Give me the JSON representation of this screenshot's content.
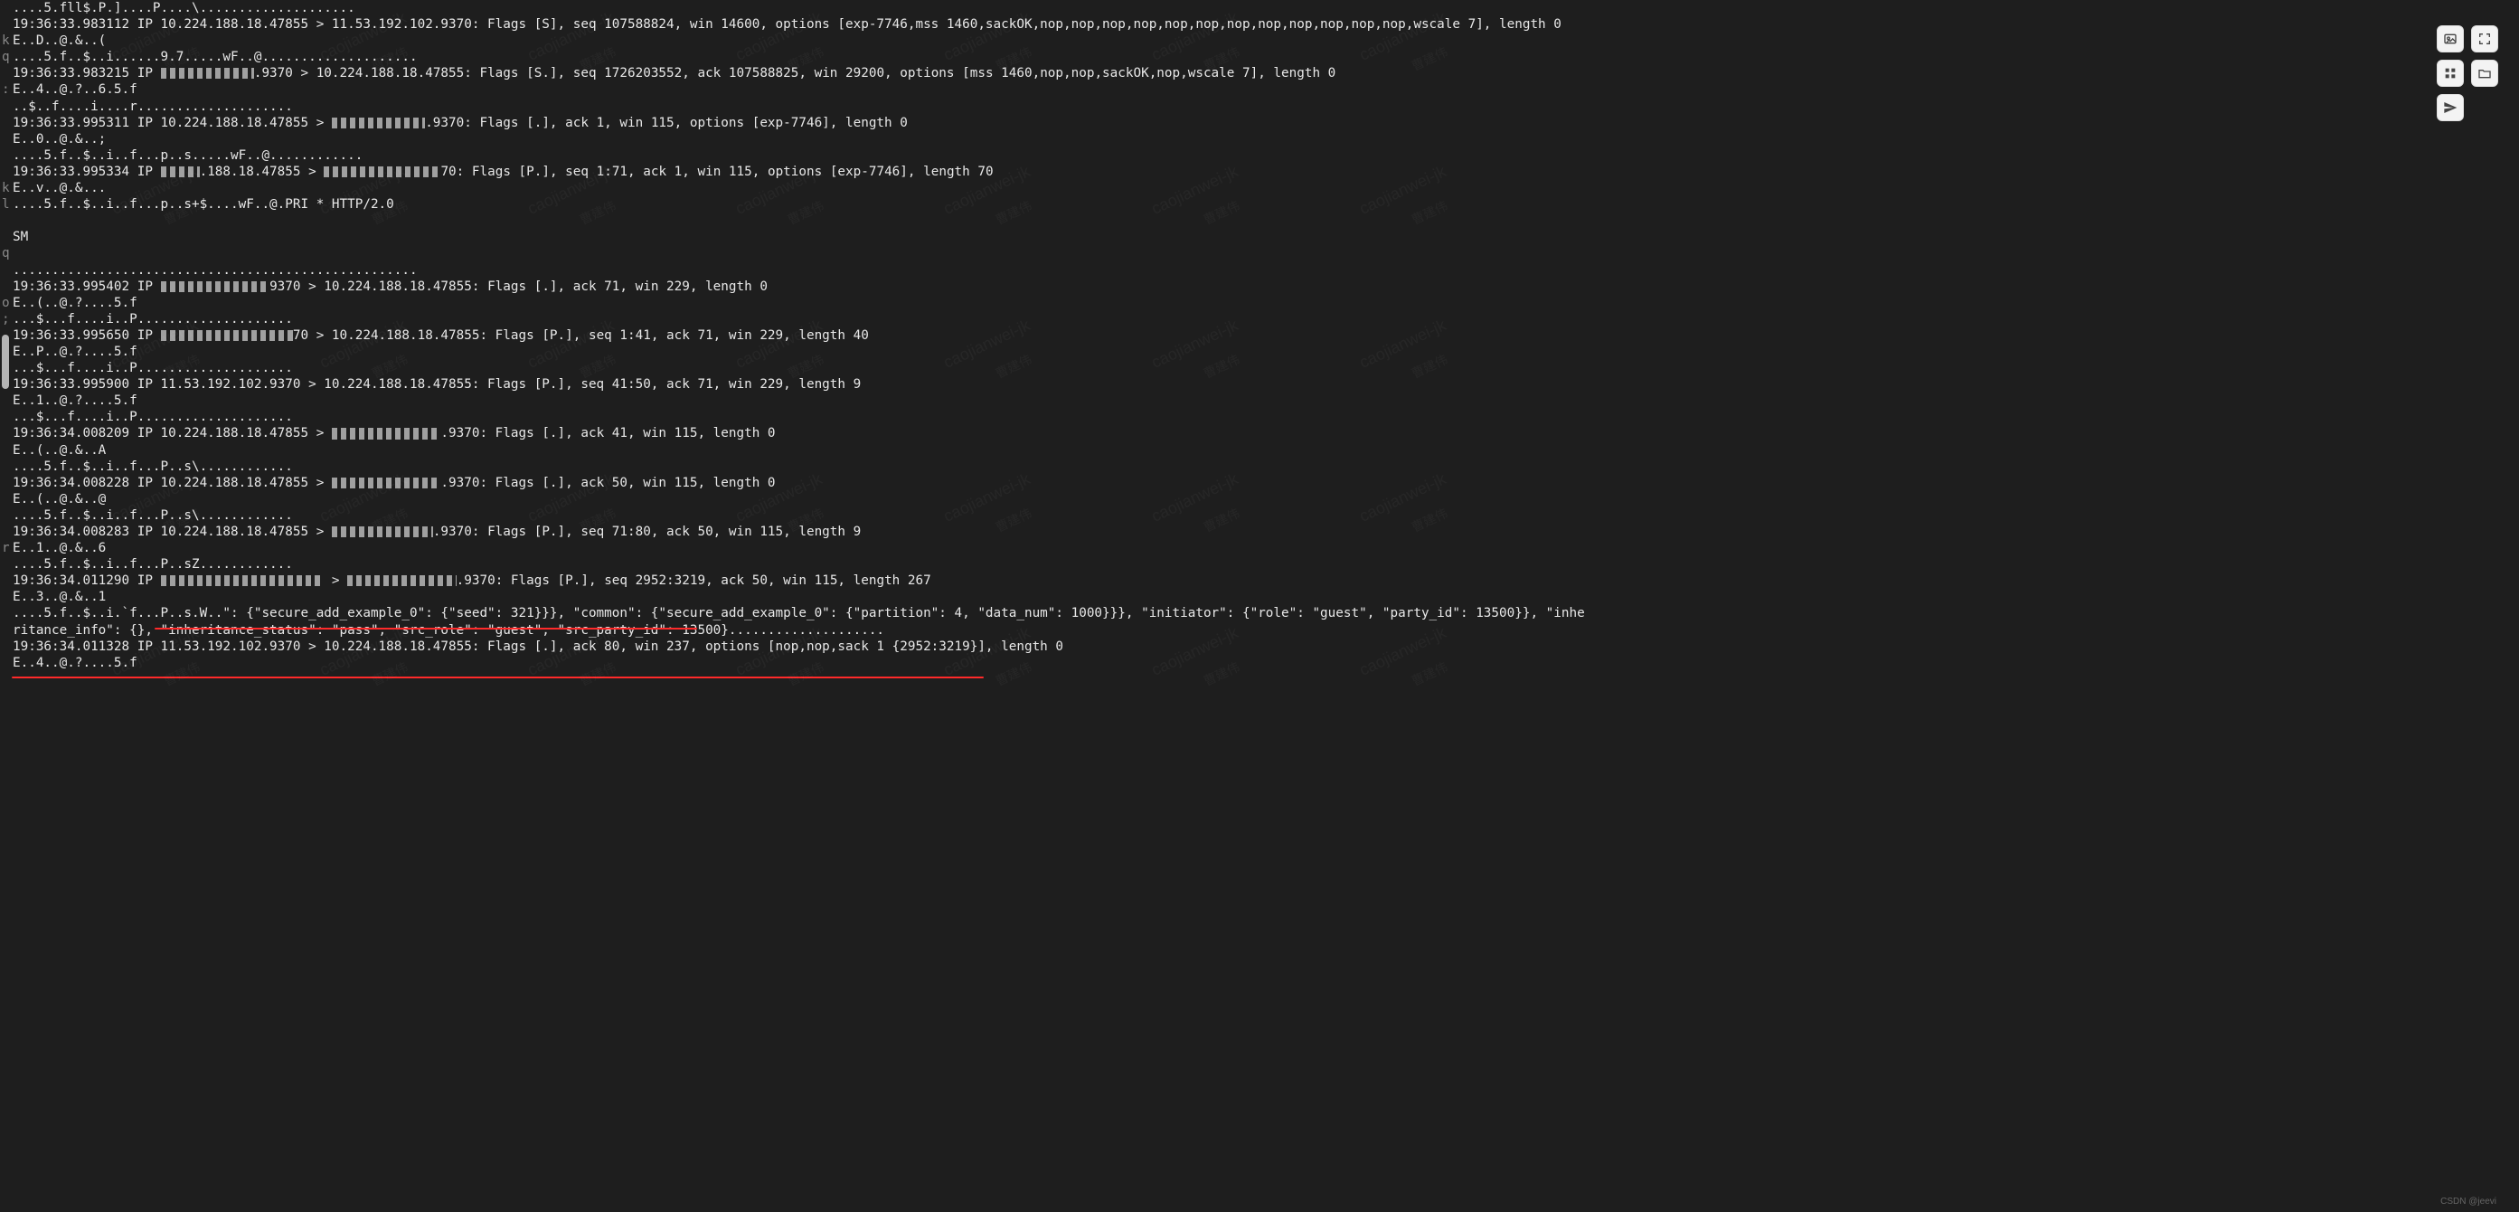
{
  "terminal": {
    "lines": [
      {
        "g": " ",
        "t": "....5.fll$.P.]....P....\\...................."
      },
      {
        "g": " ",
        "t": "19:36:33.983112 IP 10.224.188.18.47855 > 11.53.192.102.9370: Flags [S], seq 107588824, win 14600, options [exp-7746,mss 1460,sackOK,nop,nop,nop,nop,nop,nop,nop,nop,nop,nop,nop,nop,wscale 7], length 0"
      },
      {
        "g": "k",
        "t": "E..D..@.&..("
      },
      {
        "g": "q",
        "t": "....5.f..$..i......9.7.....wF..@...................."
      },
      {
        "g": " ",
        "t1": "19:36:33.983215 IP ",
        "ob": " .  .   .102",
        "t2": ".9370 > 10.224.188.18.47855: Flags [S.], seq 1726203552, ack 107588825, win 29200, options [mss 1460,nop,nop,sackOK,nop,wscale 7], length 0"
      },
      {
        "g": ":",
        "t": "E..4..@.?..6.5.f"
      },
      {
        "g": " ",
        "t": "..$..f....i....r...................."
      },
      {
        "g": " ",
        "t1": "19:36:33.995311 IP 10.224.188.18.47855 > ",
        "ob": " .  .   .102",
        "t2": ".9370: Flags [.], ack 1, win 115, options [exp-7746], length 0"
      },
      {
        "g": " ",
        "t": "E..0..@.&..;"
      },
      {
        "g": " ",
        "t": "....5.f..$..i..f...p..s.....wF..@............"
      },
      {
        "g": " ",
        "t1": "19:36:33.995334 IP ",
        "ob": " .224",
        "t2": ".188.18.47855 > ",
        "ob2": " .  .   .  .  3",
        "t3": "70: Flags [P.], seq 1:71, ack 1, win 115, options [exp-7746], length 70"
      },
      {
        "g": "k",
        "t": "E..v..@.&..."
      },
      {
        "g": "l",
        "t": "....5.f..$..i..f...p..s+$....wF..@.PRI * HTTP/2.0"
      },
      {
        "g": " ",
        "t": ""
      },
      {
        "g": " ",
        "t": "SM"
      },
      {
        "g": "q",
        "t": ""
      },
      {
        "g": " ",
        "t": "...................................................."
      },
      {
        "g": " ",
        "t1": "19:36:33.995402 IP ",
        "ob": " .   .   .    ",
        "t2": "9370 > 10.224.188.18.47855: Flags [.], ack 71, win 229, length 0"
      },
      {
        "g": "o",
        "t": "E..(..@.?....5.f"
      },
      {
        "g": ";",
        "t": "...$...f....i..P...................."
      },
      {
        "g": " ",
        "t1": "19:36:33.995650 IP ",
        "ob": " .   . .  .   . 3",
        "t2": "70 > 10.224.188.18.47855: Flags [P.], seq 1:41, ack 71, win 229, length 40"
      },
      {
        "g": " ",
        "t": "E..P..@.?....5.f"
      },
      {
        "g": " ",
        "t": "...$...f....i..P...................."
      },
      {
        "g": " ",
        "t": "19:36:33.995900 IP 11.53.192.102.9370 > 10.224.188.18.47855: Flags [P.], seq 41:50, ack 71, win 229, length 9"
      },
      {
        "g": " ",
        "t": "E..1..@.?....5.f"
      },
      {
        "g": " ",
        "t": "...$...f....i..P...................."
      },
      {
        "g": " ",
        "t1": "19:36:34.008209 IP 10.224.188.18.47855 > ",
        "ob": " .   . .. .102",
        "t2": ".9370: Flags [.], ack 41, win 115, length 0"
      },
      {
        "g": " ",
        "t": "E..(..@.&..A"
      },
      {
        "g": " ",
        "t": "....5.f..$..i..f...P..s\\............"
      },
      {
        "g": " ",
        "t1": "19:36:34.008228 IP 10.224.188.18.47855 > ",
        "ob": " .. .  .. .102",
        "t2": ".9370: Flags [.], ack 50, win 115, length 0"
      },
      {
        "g": " ",
        "t": "E..(..@.&..@"
      },
      {
        "g": " ",
        "t": "....5.f..$..i..f...P..s\\............"
      },
      {
        "g": " ",
        "t1": "19:36:34.008283 IP 10.224.188.18.47855 > ",
        "ob": " .... .  .102",
        "t2": ".9370: Flags [P.], seq 71:80, ack 50, win 115, length 9"
      },
      {
        "g": "r",
        "t": "E..1..@.&..6"
      },
      {
        "g": " ",
        "t": "....5.f..$..i..f...P..sZ............"
      },
      {
        "g": " ",
        "t1": "19:36:34.011290 IP ",
        "ob": "  .  . .   .  . 17855",
        "t2": " > ",
        "ob2": " . .  . . .102",
        "t3": ".9370: Flags [P.], seq 2952:3219, ack 50, win 115, length 267"
      },
      {
        "g": " ",
        "t": "E..3..@.&..1"
      },
      {
        "g": " ",
        "t": "....5.f..$..i.`f...P..s.W..\": {\"secure_add_example_0\": {\"seed\": 321}}}, \"common\": {\"secure_add_example_0\": {\"partition\": 4, \"data_num\": 1000}}}, \"initiator\": {\"role\": \"guest\", \"party_id\": 13500}}, \"inhe"
      },
      {
        "g": " ",
        "t": "ritance_info\": {}, \"inheritance_status\": \"pass\", \"src_role\": \"guest\", \"src_party_id\": 13500}...................."
      },
      {
        "g": " ",
        "t": "19:36:34.011328 IP 11.53.192.102.9370 > 10.224.188.18.47855: Flags [.], ack 80, win 237, options [nop,nop,sack 1 {2952:3219}], length 0"
      },
      {
        "g": " ",
        "t": "E..4..@.?....5.f"
      }
    ]
  },
  "highlight_json": {
    "secure_add_example_0_seed": 321,
    "common": {
      "secure_add_example_0": {
        "partition": 4,
        "data_num": 1000
      }
    },
    "initiator": {
      "role": "guest",
      "party_id": 13500
    },
    "inheritance_info": {},
    "inheritance_status": "pass",
    "src_role": "guest",
    "src_party_id": 13500
  },
  "toolbar": {
    "image": "image",
    "fullscreen": "fullscreen",
    "grid": "grid",
    "folder": "folder",
    "send": "send"
  },
  "watermark": {
    "text": "caojianwei-jk",
    "cn": "曹建伟"
  },
  "footer": "CSDN @jeevi"
}
